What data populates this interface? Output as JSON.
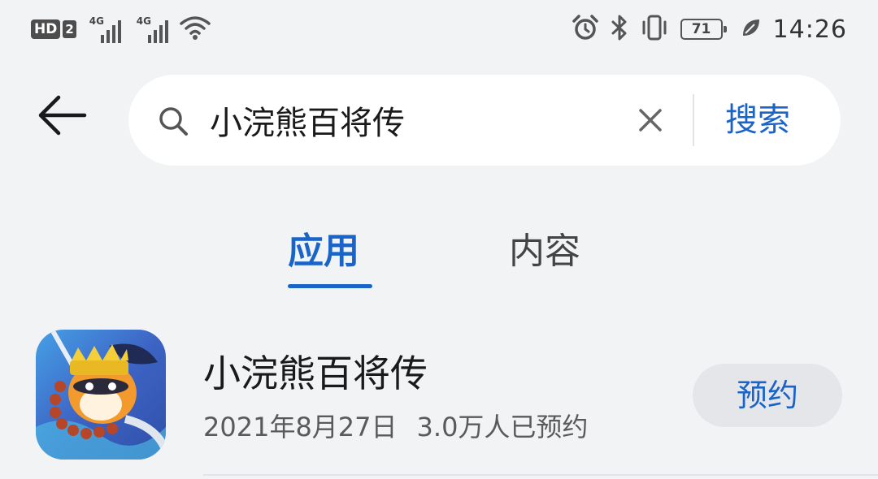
{
  "status_bar": {
    "hd": "HD",
    "sim": "2",
    "net1": "4G",
    "net2": "4G",
    "battery": "71",
    "time": "14:26"
  },
  "search": {
    "query": "小浣熊百将传",
    "button_label": "搜索"
  },
  "tabs": [
    {
      "label": "应用",
      "active": true
    },
    {
      "label": "内容",
      "active": false
    }
  ],
  "results": [
    {
      "name": "小浣熊百将传",
      "date": "2021年8月27日",
      "reservations": "3.0万人已预约",
      "action": "预约"
    }
  ],
  "colors": {
    "accent": "#1a64c8",
    "background": "#f1f3f5",
    "button_bg": "#e4e6e9"
  }
}
